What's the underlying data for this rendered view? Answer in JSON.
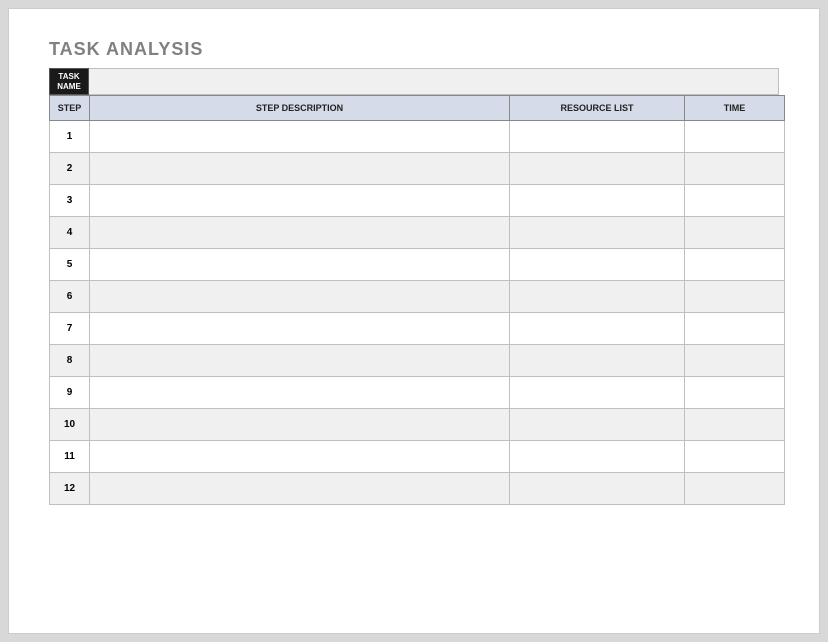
{
  "title": "TASK ANALYSIS",
  "taskNameLabel": "TASK NAME",
  "taskNameValue": "",
  "headers": {
    "step": "STEP",
    "desc": "STEP DESCRIPTION",
    "res": "RESOURCE LIST",
    "time": "TIME"
  },
  "rows": [
    {
      "step": "1",
      "desc": "",
      "res": "",
      "time": ""
    },
    {
      "step": "2",
      "desc": "",
      "res": "",
      "time": ""
    },
    {
      "step": "3",
      "desc": "",
      "res": "",
      "time": ""
    },
    {
      "step": "4",
      "desc": "",
      "res": "",
      "time": ""
    },
    {
      "step": "5",
      "desc": "",
      "res": "",
      "time": ""
    },
    {
      "step": "6",
      "desc": "",
      "res": "",
      "time": ""
    },
    {
      "step": "7",
      "desc": "",
      "res": "",
      "time": ""
    },
    {
      "step": "8",
      "desc": "",
      "res": "",
      "time": ""
    },
    {
      "step": "9",
      "desc": "",
      "res": "",
      "time": ""
    },
    {
      "step": "10",
      "desc": "",
      "res": "",
      "time": ""
    },
    {
      "step": "11",
      "desc": "",
      "res": "",
      "time": ""
    },
    {
      "step": "12",
      "desc": "",
      "res": "",
      "time": ""
    }
  ]
}
